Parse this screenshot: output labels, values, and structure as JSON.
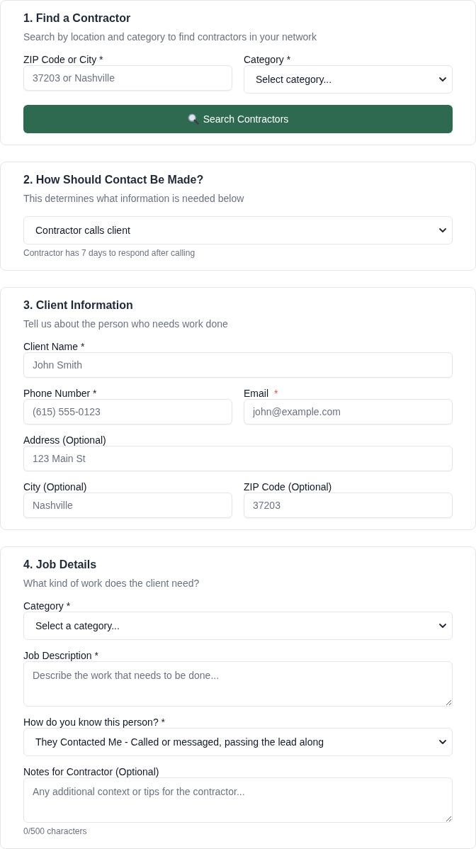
{
  "sections": [
    {
      "title": "1. Find a Contractor",
      "subtitle": "Search by location and category to find contractors in your network",
      "rows": [
        [
          {
            "kind": "input",
            "label": "ZIP Code or City *",
            "placeholder": "37203 or Nashville"
          },
          {
            "kind": "select",
            "label": "Category *",
            "value": "Select category..."
          }
        ]
      ],
      "button": {
        "label": "Search Contractors"
      }
    },
    {
      "title": "2. How Should Contact Be Made?",
      "subtitle": "This determines what information is needed below",
      "rows": [
        [
          {
            "kind": "select",
            "value": "Contractor calls client",
            "hint": "Contractor has 7 days to respond after calling"
          }
        ]
      ]
    },
    {
      "title": "3. Client Information",
      "subtitle": "Tell us about the person who needs work done",
      "rows": [
        [
          {
            "kind": "input",
            "label": "Client Name *",
            "placeholder": "John Smith"
          }
        ],
        [
          {
            "kind": "input",
            "label": "Phone Number *",
            "placeholder": "(615) 555-0123"
          },
          {
            "kind": "input",
            "label": "Email",
            "required_mark": "*",
            "placeholder": "john@example.com"
          }
        ],
        [
          {
            "kind": "input",
            "label": "Address (Optional)",
            "placeholder": "123 Main St"
          }
        ],
        [
          {
            "kind": "input",
            "label": "City (Optional)",
            "placeholder": "Nashville"
          },
          {
            "kind": "input",
            "label": "ZIP Code (Optional)",
            "placeholder": "37203"
          }
        ]
      ]
    },
    {
      "title": "4. Job Details",
      "subtitle": "What kind of work does the client need?",
      "rows": [
        [
          {
            "kind": "select",
            "label": "Category *",
            "value": "Select a category..."
          }
        ],
        [
          {
            "kind": "textarea",
            "label": "Job Description *",
            "placeholder": "Describe the work that needs to be done..."
          }
        ],
        [
          {
            "kind": "select",
            "label": "How do you know this person? *",
            "value": "They Contacted Me - Called or messaged, passing the lead along"
          }
        ],
        [
          {
            "kind": "textarea",
            "label": "Notes for Contractor (Optional)",
            "placeholder": "Any additional context or tips for the contractor...",
            "hint": "0/500 characters"
          }
        ]
      ]
    }
  ]
}
